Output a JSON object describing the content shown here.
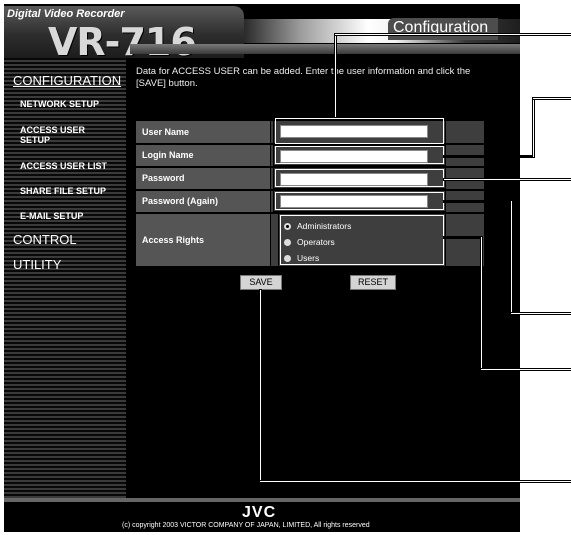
{
  "app": {
    "brand_label": "Digital Video Recorder",
    "model": "VR-716",
    "page_title": "Configuration"
  },
  "sidebar": {
    "section_configuration": "CONFIGURATION",
    "items": [
      {
        "label": "NETWORK SETUP"
      },
      {
        "label": "ACCESS USER SETUP"
      },
      {
        "label": "ACCESS USER LIST"
      },
      {
        "label": "SHARE FILE SETUP"
      },
      {
        "label": "E-MAIL SETUP"
      }
    ],
    "section_control": "CONTROL",
    "section_utility": "UTILITY"
  },
  "main": {
    "intro_text": "Data for ACCESS USER can be added. Enter the user information and click the [SAVE] button.",
    "fields": {
      "user_name_label": "User Name",
      "login_name_label": "Login Name",
      "password_label": "Password",
      "password_again_label": "Password (Again)",
      "access_rights_label": "Access Rights"
    },
    "access_rights_options": [
      {
        "label": "Administrators",
        "selected": true
      },
      {
        "label": "Operators",
        "selected": false
      },
      {
        "label": "Users",
        "selected": false
      }
    ],
    "save_label": "SAVE",
    "reset_label": "RESET"
  },
  "footer": {
    "logo": "JVC",
    "copyright": "(c) copyright 2003 VICTOR COMPANY OF JAPAN, LIMITED, All rights reserved"
  },
  "colors": {
    "background": "#000000",
    "label_bg": "#555555",
    "text": "#ffffff"
  }
}
